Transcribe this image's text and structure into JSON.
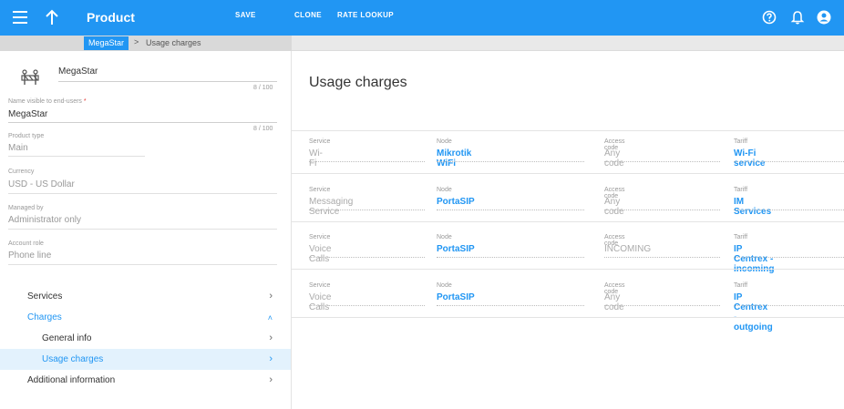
{
  "topbar": {
    "title": "Product",
    "save_label": "SAVE",
    "clone_label": "CLONE",
    "rate_lookup_label": "RATE LOOKUP"
  },
  "breadcrumb": {
    "link": "MegaStar",
    "separator": ">",
    "current": "Usage charges"
  },
  "form": {
    "product_name": {
      "value": "MegaStar",
      "counter": "8 / 100"
    },
    "visible_name": {
      "label": "Name visible to end-users",
      "required_mark": "*",
      "value": "MegaStar",
      "counter": "8 / 100"
    },
    "product_type": {
      "label": "Product type",
      "value": "Main"
    },
    "currency": {
      "label": "Currency",
      "value": "USD - US Dollar"
    },
    "managed_by": {
      "label": "Managed by",
      "value": "Administrator only"
    },
    "account_role": {
      "label": "Account role",
      "value": "Phone line"
    }
  },
  "nav": {
    "services": "Services",
    "charges": "Charges",
    "general_info": "General info",
    "usage_charges": "Usage charges",
    "additional_information": "Additional information",
    "chevron_right": "›",
    "chevron_up": "˄"
  },
  "main": {
    "heading": "Usage charges",
    "column_labels": {
      "service": "Service",
      "node": "Node",
      "access_code": "Access code",
      "tariff": "Tariff"
    },
    "rows": [
      {
        "service": "Wi-Fi",
        "node": "Mikrotik WiFi",
        "access_code": "Any code",
        "tariff": "Wi-Fi service"
      },
      {
        "service": "Messaging Service",
        "node": "PortaSIP",
        "access_code": "Any code",
        "tariff": "IM Services"
      },
      {
        "service": "Voice Calls",
        "node": "PortaSIP",
        "access_code": "INCOMING",
        "tariff": "IP Centrex - incoming"
      },
      {
        "service": "Voice Calls",
        "node": "PortaSIP",
        "access_code": "Any code",
        "tariff": "IP Centrex - outgoing"
      }
    ]
  },
  "colors": {
    "accent": "#2196f3",
    "active_bg": "#e3f2fd",
    "required": "#e53935"
  },
  "icons": {
    "menu": "menu-icon",
    "back": "arrow-up-icon",
    "help": "help-circle-icon",
    "notifications": "bell-icon",
    "user": "account-circle-icon",
    "product": "product-barrier-icon"
  }
}
